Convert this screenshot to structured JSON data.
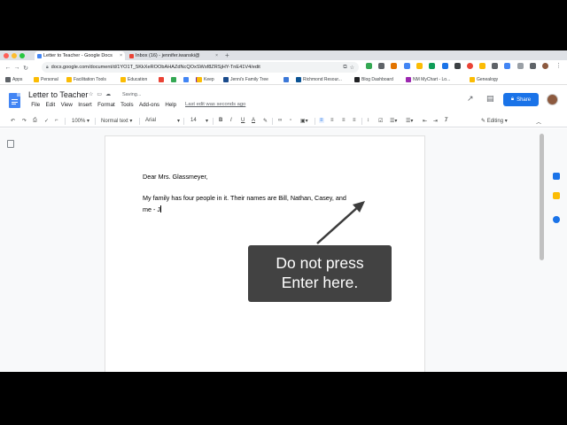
{
  "browser": {
    "tabs": [
      {
        "label": "Letter to Teacher - Google Docs",
        "favicon_color": "#4285f4"
      },
      {
        "label": "Inbox (16) - jennifer.iwanski@",
        "favicon_color": "#ea4335"
      }
    ],
    "new_tab": "+",
    "close_glyph": "×",
    "url": "docs.google.com/document/d/1YO1T_5KkXeROObAHAZdNcQOxSWsf8ZRSjHY-TnE41V4/edit",
    "bookmarks": [
      {
        "label": "Apps",
        "color": "#5f6368"
      },
      {
        "label": "Personal",
        "color": "#fbbc04"
      },
      {
        "label": "Facilitation Tools",
        "color": "#fbbc04"
      },
      {
        "label": "Education",
        "color": "#fbbc04"
      },
      {
        "label": "",
        "color": "#ea4335"
      },
      {
        "label": "",
        "color": "#34a853"
      },
      {
        "label": "",
        "color": "#4285f4"
      },
      {
        "label": "",
        "color": "#7b1fa2"
      },
      {
        "label": "Keep",
        "color": "#fbbc04"
      },
      {
        "label": "Jenni's Family Tree",
        "color": "#1a4b8c"
      },
      {
        "label": "",
        "color": "#3c78d8"
      },
      {
        "label": "Richmond Resour...",
        "color": "#0b5394"
      },
      {
        "label": "Blog Dashboard",
        "color": "#202124"
      },
      {
        "label": "NM MyChart - Lo...",
        "color": "#9c27b0"
      },
      {
        "label": "Genealogy",
        "color": "#fbbc04"
      }
    ]
  },
  "docs": {
    "title": "Letter to Teacher",
    "status": "Saving...",
    "menu": [
      "File",
      "Edit",
      "View",
      "Insert",
      "Format",
      "Tools",
      "Add-ons",
      "Help"
    ],
    "last_edit": "Last edit was seconds ago",
    "share_label": "Share",
    "accent": "#1a73e8"
  },
  "toolbar": {
    "zoom": "100%",
    "style": "Normal text",
    "font": "Arial",
    "size": "14",
    "mode": "Editing"
  },
  "document": {
    "line1": "Dear Mrs. Glassmeyer,",
    "line2": "My family has four people in it. Their names are Bill, Nathan, Casey, and",
    "line3": "me - J"
  },
  "annotation": {
    "line1": "Do not press",
    "line2": "Enter here."
  }
}
